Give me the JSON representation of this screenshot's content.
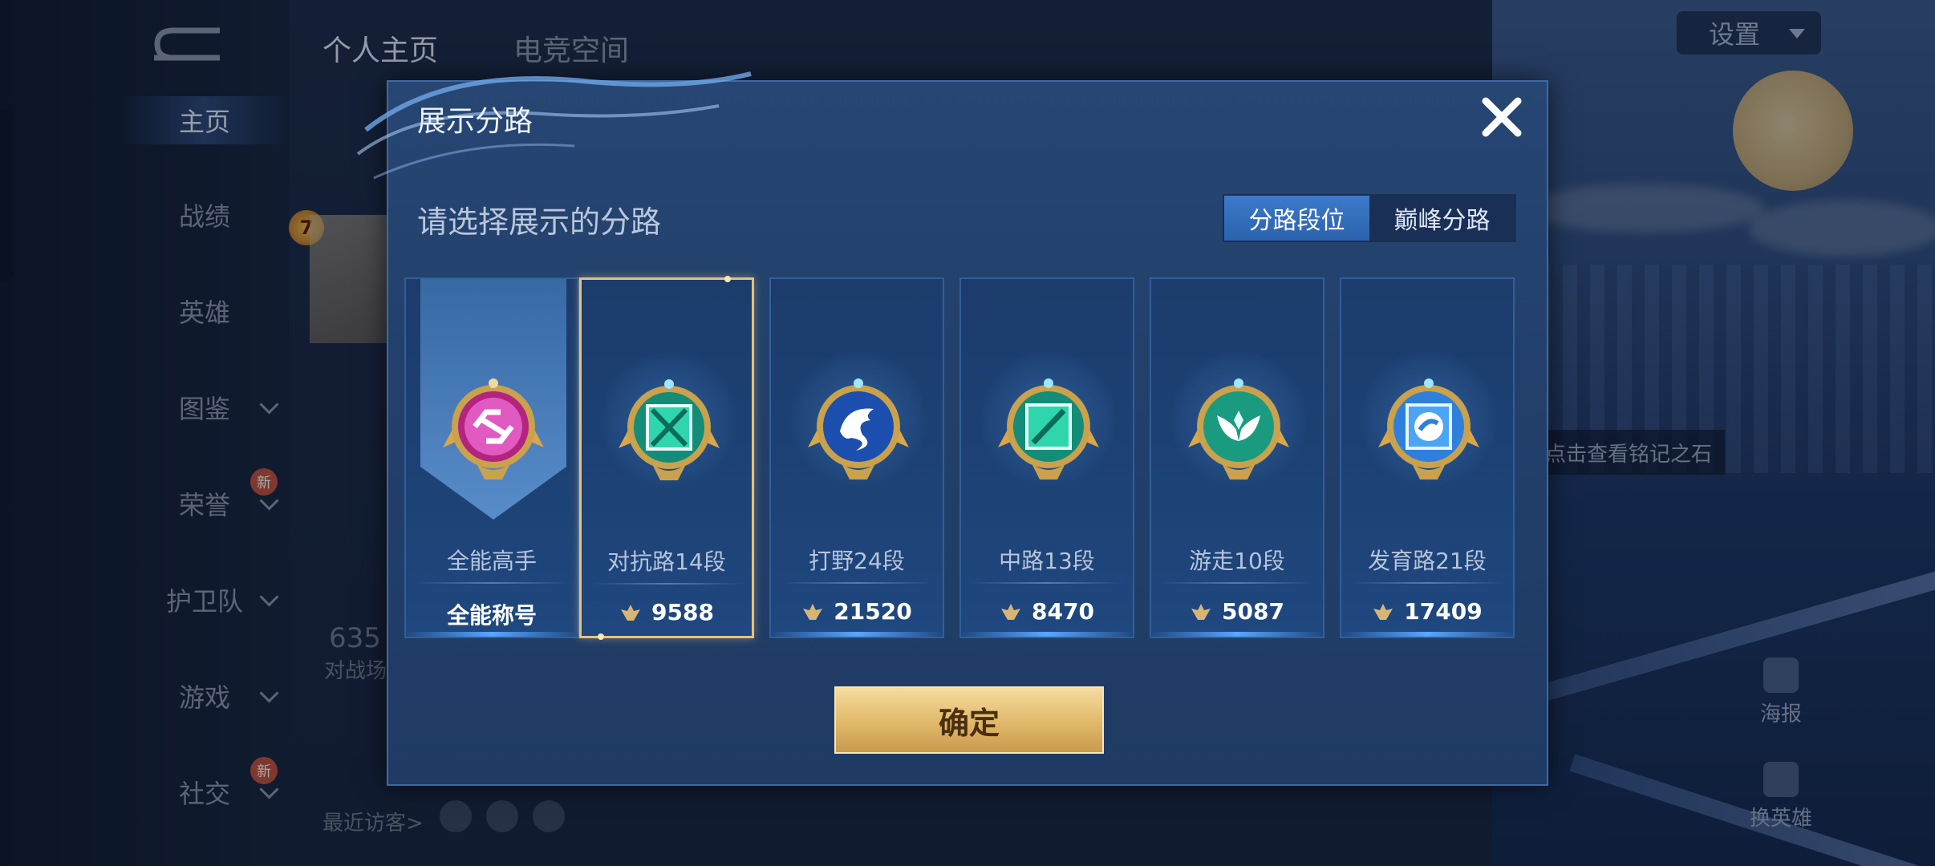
{
  "sidebar": {
    "items": [
      {
        "label": "主页",
        "active": true
      },
      {
        "label": "战绩"
      },
      {
        "label": "英雄"
      },
      {
        "label": "图鉴",
        "expand": true
      },
      {
        "label": "荣誉",
        "expand": true,
        "badge": "新"
      },
      {
        "label": "护卫队",
        "expand": true
      },
      {
        "label": "游戏",
        "expand": true
      },
      {
        "label": "社交",
        "expand": true,
        "badge": "新"
      }
    ]
  },
  "header": {
    "tabs": [
      {
        "label": "个人主页",
        "active": true
      },
      {
        "label": "电竞空间"
      }
    ],
    "settings_label": "设置"
  },
  "background": {
    "level_badge": "7",
    "stat_number": "635",
    "stat_label": "对战场",
    "visitors_label": "最近访客>",
    "tip_text": "点击查看铭记之石",
    "poster_label": "海报",
    "swap_hero_label": "换英雄",
    "new_badge": "新"
  },
  "modal": {
    "title": "展示分路",
    "subtitle": "请选择展示的分路",
    "toggle": [
      {
        "label": "分路段位",
        "active": true
      },
      {
        "label": "巅峰分路",
        "active": false
      }
    ],
    "cards": [
      {
        "name": "全能高手",
        "value": "全能称号",
        "selected": false,
        "emblem": "allround-emblem",
        "color": "#c2339b"
      },
      {
        "name": "对抗路14段",
        "value": "9588",
        "selected": true,
        "emblem": "clash-lane-emblem",
        "color": "#1fbf9a"
      },
      {
        "name": "打野24段",
        "value": "21520",
        "selected": false,
        "emblem": "jungle-emblem",
        "color": "#2b63c9"
      },
      {
        "name": "中路13段",
        "value": "8470",
        "selected": false,
        "emblem": "mid-lane-emblem",
        "color": "#1fbf9a"
      },
      {
        "name": "游走10段",
        "value": "5087",
        "selected": false,
        "emblem": "roam-emblem",
        "color": "#1fa98a"
      },
      {
        "name": "发育路21段",
        "value": "17409",
        "selected": false,
        "emblem": "farm-lane-emblem",
        "color": "#3a8ee6"
      }
    ],
    "confirm_label": "确定"
  },
  "colors": {
    "gold": "#e6c07b",
    "accent_blue": "#3d7ac9",
    "modal_bg": "#22406b"
  }
}
